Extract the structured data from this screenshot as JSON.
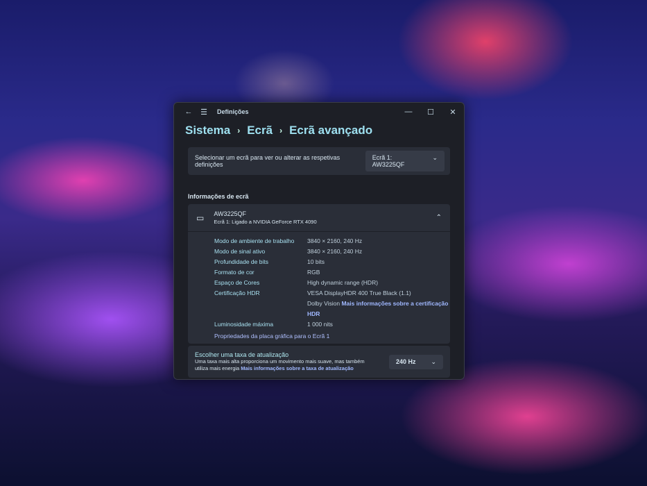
{
  "window": {
    "title": "Definições",
    "minimize": "—",
    "maximize": "☐",
    "close": "✕"
  },
  "breadcrumb": [
    "Sistema",
    "Ecrã",
    "Ecrã avançado"
  ],
  "select": {
    "label": "Selecionar um ecrã para ver ou alterar as respetivas definições",
    "value": "Ecrã 1: AW3225QF"
  },
  "section_title": "Informações de ecrã",
  "display": {
    "name": "AW3225QF",
    "subtitle": "Ecrã 1: Ligado a NVIDIA GeForce RTX 4090",
    "rows": [
      {
        "k": "Modo de ambiente de trabalho",
        "v": "3840 × 2160, 240 Hz"
      },
      {
        "k": "Modo de sinal ativo",
        "v": "3840 × 2160, 240 Hz"
      },
      {
        "k": "Profundidade de bits",
        "v": "10 bits"
      },
      {
        "k": "Formato de cor",
        "v": "RGB"
      },
      {
        "k": "Espaço de Cores",
        "v": "High dynamic range (HDR)"
      },
      {
        "k": "Certificação HDR",
        "v": "VESA DisplayHDR 400 True Black (1.1)",
        "v2": "Dolby Vision",
        "link": "Mais informações sobre a certificação HDR"
      },
      {
        "k": "Luminosidade máxima",
        "v": "1 000 nits"
      }
    ],
    "gpu_link": "Propriedades da placa gráfica para o Ecrã 1"
  },
  "refresh": {
    "title": "Escolher uma taxa de atualização",
    "desc": "Uma taxa mais alta proporciona um movimento mais suave, mas também utiliza mais energia",
    "link": "Mais informações sobre a taxa de atualização",
    "value": "240 Hz"
  }
}
